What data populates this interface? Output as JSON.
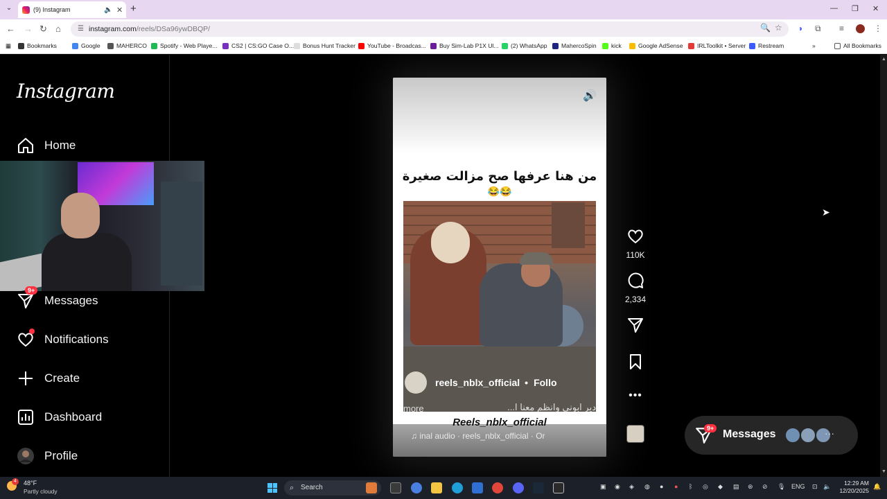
{
  "browser": {
    "tab_title": "(9) Instagram",
    "url_host": "instagram.com",
    "url_path": "/reels/DSa96ywDBQP/",
    "bookmarks": [
      {
        "label": "Bookmarks",
        "color": "#333333"
      },
      {
        "label": "Google",
        "color": "#4285f4"
      },
      {
        "label": "MAHERCO",
        "color": "#555555"
      },
      {
        "label": "Spotify - Web Playe...",
        "color": "#1db954"
      },
      {
        "label": "CS2 | CS:GO Case O...",
        "color": "#7b2fbf"
      },
      {
        "label": "Bonus Hunt Tracker",
        "color": "#dddddd"
      },
      {
        "label": "YouTube - Broadcas...",
        "color": "#ff0000"
      },
      {
        "label": "Buy Sim-Lab P1X Ul...",
        "color": "#6a1b9a"
      },
      {
        "label": "(2) WhatsApp",
        "color": "#25d366"
      },
      {
        "label": "MahercoSpin",
        "color": "#1a237e"
      },
      {
        "label": "kick",
        "color": "#53fc18"
      },
      {
        "label": "Google AdSense",
        "color": "#fbbc04"
      },
      {
        "label": "IRLToolkit • Server",
        "color": "#e53935"
      },
      {
        "label": "Restream",
        "color": "#3d5afe"
      }
    ],
    "all_bookmarks": "All Bookmarks"
  },
  "sidebar": {
    "logo": "Instagram",
    "items": [
      {
        "label": "Home"
      },
      {
        "label": "Messages",
        "badge": "9+"
      },
      {
        "label": "Notifications"
      },
      {
        "label": "Create"
      },
      {
        "label": "Dashboard"
      },
      {
        "label": "Profile"
      }
    ]
  },
  "reel": {
    "caption": "من هنا عرفها صح مزالت صغيرة",
    "emojis": "😂😂",
    "username": "reels_nblx_official",
    "separator": "•",
    "follow": "Follo",
    "text_line": "دير ابوني وانظم معنا ا...",
    "more": "more",
    "watermark": "Reels_nblx_official",
    "audio": "inal audio · reels_nblx_official · Or"
  },
  "actions": {
    "likes": "110K",
    "comments": "2,334"
  },
  "messages_pill": {
    "label": "Messages",
    "badge": "9+",
    "more": "···"
  },
  "taskbar": {
    "weather_badge": "4",
    "temperature": "48°F",
    "condition": "Partly cloudy",
    "search": "Search",
    "language": "ENG",
    "time": "12:29 AM",
    "date": "12/20/2025"
  }
}
